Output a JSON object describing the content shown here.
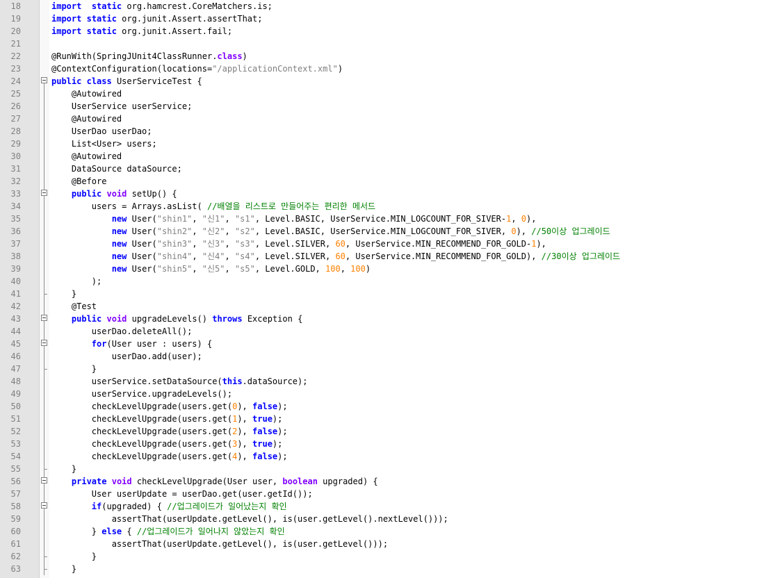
{
  "editor": {
    "colors": {
      "keyword": "#0000ff",
      "type_keyword": "#8000ff",
      "string": "#808080",
      "number": "#ff8000",
      "comment": "#008000",
      "gutter": "#e4e4e4"
    },
    "lines": [
      {
        "n": "18",
        "fold": "line",
        "tokens": [
          [
            "kw",
            "import"
          ],
          [
            "",
            "  "
          ],
          [
            "kw",
            "static"
          ],
          [
            "",
            " org.hamcrest.CoreMatchers.is;"
          ]
        ]
      },
      {
        "n": "19",
        "fold": "line",
        "tokens": [
          [
            "kw",
            "import"
          ],
          [
            "",
            " "
          ],
          [
            "kw",
            "static"
          ],
          [
            "",
            " org.junit.Assert.assertThat;"
          ]
        ]
      },
      {
        "n": "20",
        "fold": "line",
        "tokens": [
          [
            "kw",
            "import"
          ],
          [
            "",
            " "
          ],
          [
            "kw",
            "static"
          ],
          [
            "",
            " org.junit.Assert.fail;"
          ]
        ]
      },
      {
        "n": "21",
        "fold": "line",
        "tokens": []
      },
      {
        "n": "22",
        "fold": "line",
        "tokens": [
          [
            "",
            "@RunWith(SpringJUnit4ClassRunner."
          ],
          [
            "kw2",
            "class"
          ],
          [
            "",
            ")"
          ]
        ]
      },
      {
        "n": "23",
        "fold": "line",
        "tokens": [
          [
            "",
            "@ContextConfiguration(locations="
          ],
          [
            "str",
            "\"/applicationContext.xml\""
          ],
          [
            "",
            ")"
          ]
        ]
      },
      {
        "n": "24",
        "fold": "box-top",
        "tokens": [
          [
            "kw",
            "public"
          ],
          [
            "",
            " "
          ],
          [
            "kw",
            "class"
          ],
          [
            "",
            " UserServiceTest {"
          ]
        ]
      },
      {
        "n": "25",
        "fold": "line",
        "tokens": [
          [
            "",
            "    @Autowired"
          ]
        ]
      },
      {
        "n": "26",
        "fold": "line",
        "tokens": [
          [
            "",
            "    UserService userService;"
          ]
        ]
      },
      {
        "n": "27",
        "fold": "line",
        "tokens": [
          [
            "",
            "    @Autowired"
          ]
        ]
      },
      {
        "n": "28",
        "fold": "line",
        "tokens": [
          [
            "",
            "    UserDao userDao;"
          ]
        ]
      },
      {
        "n": "29",
        "fold": "line",
        "tokens": [
          [
            "",
            "    List<User> users;"
          ]
        ]
      },
      {
        "n": "30",
        "fold": "line",
        "tokens": [
          [
            "",
            "    @Autowired"
          ]
        ]
      },
      {
        "n": "31",
        "fold": "line",
        "tokens": [
          [
            "",
            "    DataSource dataSource;"
          ]
        ]
      },
      {
        "n": "32",
        "fold": "line",
        "tokens": [
          [
            "",
            "    @Before"
          ]
        ]
      },
      {
        "n": "33",
        "fold": "box",
        "tokens": [
          [
            "",
            "    "
          ],
          [
            "kw",
            "public"
          ],
          [
            "",
            " "
          ],
          [
            "kw2",
            "void"
          ],
          [
            "",
            " setUp() {"
          ]
        ]
      },
      {
        "n": "34",
        "fold": "line",
        "tokens": [
          [
            "",
            "        users = Arrays.asList( "
          ],
          [
            "cmt",
            "//배열을 리스트로 만들어주는 편리한 메서드"
          ]
        ]
      },
      {
        "n": "35",
        "fold": "line",
        "tokens": [
          [
            "",
            "            "
          ],
          [
            "kw",
            "new"
          ],
          [
            "",
            " User("
          ],
          [
            "str",
            "\"shin1\""
          ],
          [
            "",
            ", "
          ],
          [
            "str",
            "\"신1\""
          ],
          [
            "",
            ", "
          ],
          [
            "str",
            "\"s1\""
          ],
          [
            "",
            ", Level.BASIC, UserService.MIN_LOGCOUNT_FOR_SIVER-"
          ],
          [
            "num",
            "1"
          ],
          [
            "",
            ", "
          ],
          [
            "num",
            "0"
          ],
          [
            "",
            "),"
          ]
        ]
      },
      {
        "n": "36",
        "fold": "line",
        "tokens": [
          [
            "",
            "            "
          ],
          [
            "kw",
            "new"
          ],
          [
            "",
            " User("
          ],
          [
            "str",
            "\"shin2\""
          ],
          [
            "",
            ", "
          ],
          [
            "str",
            "\"신2\""
          ],
          [
            "",
            ", "
          ],
          [
            "str",
            "\"s2\""
          ],
          [
            "",
            ", Level.BASIC, UserService.MIN_LOGCOUNT_FOR_SIVER, "
          ],
          [
            "num",
            "0"
          ],
          [
            "",
            "), "
          ],
          [
            "cmt",
            "//50이상 업그레이드"
          ]
        ]
      },
      {
        "n": "37",
        "fold": "line",
        "tokens": [
          [
            "",
            "            "
          ],
          [
            "kw",
            "new"
          ],
          [
            "",
            " User("
          ],
          [
            "str",
            "\"shin3\""
          ],
          [
            "",
            ", "
          ],
          [
            "str",
            "\"신3\""
          ],
          [
            "",
            ", "
          ],
          [
            "str",
            "\"s3\""
          ],
          [
            "",
            ", Level.SILVER, "
          ],
          [
            "num",
            "60"
          ],
          [
            "",
            ", UserService.MIN_RECOMMEND_FOR_GOLD-"
          ],
          [
            "num",
            "1"
          ],
          [
            "",
            "),"
          ]
        ]
      },
      {
        "n": "38",
        "fold": "line",
        "tokens": [
          [
            "",
            "            "
          ],
          [
            "kw",
            "new"
          ],
          [
            "",
            " User("
          ],
          [
            "str",
            "\"shin4\""
          ],
          [
            "",
            ", "
          ],
          [
            "str",
            "\"신4\""
          ],
          [
            "",
            ", "
          ],
          [
            "str",
            "\"s4\""
          ],
          [
            "",
            ", Level.SILVER, "
          ],
          [
            "num",
            "60"
          ],
          [
            "",
            ", UserService.MIN_RECOMMEND_FOR_GOLD), "
          ],
          [
            "cmt",
            "//30이상 업그레이드"
          ]
        ]
      },
      {
        "n": "39",
        "fold": "line",
        "tokens": [
          [
            "",
            "            "
          ],
          [
            "kw",
            "new"
          ],
          [
            "",
            " User("
          ],
          [
            "str",
            "\"shin5\""
          ],
          [
            "",
            ", "
          ],
          [
            "str",
            "\"신5\""
          ],
          [
            "",
            ", "
          ],
          [
            "str",
            "\"s5\""
          ],
          [
            "",
            ", Level.GOLD, "
          ],
          [
            "num",
            "100"
          ],
          [
            "",
            ", "
          ],
          [
            "num",
            "100"
          ],
          [
            "",
            ")"
          ]
        ]
      },
      {
        "n": "40",
        "fold": "line",
        "tokens": [
          [
            "",
            "        );"
          ]
        ]
      },
      {
        "n": "41",
        "fold": "tee",
        "tokens": [
          [
            "",
            "    }"
          ]
        ]
      },
      {
        "n": "42",
        "fold": "line",
        "tokens": [
          [
            "",
            "    @Test"
          ]
        ]
      },
      {
        "n": "43",
        "fold": "box",
        "tokens": [
          [
            "",
            "    "
          ],
          [
            "kw",
            "public"
          ],
          [
            "",
            " "
          ],
          [
            "kw2",
            "void"
          ],
          [
            "",
            " upgradeLevels() "
          ],
          [
            "kw",
            "throws"
          ],
          [
            "",
            " Exception {"
          ]
        ]
      },
      {
        "n": "44",
        "fold": "line",
        "tokens": [
          [
            "",
            "        userDao.deleteAll();"
          ]
        ]
      },
      {
        "n": "45",
        "fold": "box",
        "tokens": [
          [
            "",
            "        "
          ],
          [
            "kw",
            "for"
          ],
          [
            "",
            "(User user : users) {"
          ]
        ]
      },
      {
        "n": "46",
        "fold": "line",
        "tokens": [
          [
            "",
            "            userDao.add(user);"
          ]
        ]
      },
      {
        "n": "47",
        "fold": "tee",
        "tokens": [
          [
            "",
            "        }"
          ]
        ]
      },
      {
        "n": "48",
        "fold": "line",
        "tokens": [
          [
            "",
            "        userService.setDataSource("
          ],
          [
            "kw",
            "this"
          ],
          [
            "",
            ".dataSource);"
          ]
        ]
      },
      {
        "n": "49",
        "fold": "line",
        "tokens": [
          [
            "",
            "        userService.upgradeLevels();"
          ]
        ]
      },
      {
        "n": "50",
        "fold": "line",
        "tokens": [
          [
            "",
            "        checkLevelUpgrade(users.get("
          ],
          [
            "num",
            "0"
          ],
          [
            "",
            "), "
          ],
          [
            "kw",
            "false"
          ],
          [
            "",
            ");"
          ]
        ]
      },
      {
        "n": "51",
        "fold": "line",
        "tokens": [
          [
            "",
            "        checkLevelUpgrade(users.get("
          ],
          [
            "num",
            "1"
          ],
          [
            "",
            "), "
          ],
          [
            "kw",
            "true"
          ],
          [
            "",
            ");"
          ]
        ]
      },
      {
        "n": "52",
        "fold": "line",
        "tokens": [
          [
            "",
            "        checkLevelUpgrade(users.get("
          ],
          [
            "num",
            "2"
          ],
          [
            "",
            "), "
          ],
          [
            "kw",
            "false"
          ],
          [
            "",
            ");"
          ]
        ]
      },
      {
        "n": "53",
        "fold": "line",
        "tokens": [
          [
            "",
            "        checkLevelUpgrade(users.get("
          ],
          [
            "num",
            "3"
          ],
          [
            "",
            "), "
          ],
          [
            "kw",
            "true"
          ],
          [
            "",
            ");"
          ]
        ]
      },
      {
        "n": "54",
        "fold": "line",
        "tokens": [
          [
            "",
            "        checkLevelUpgrade(users.get("
          ],
          [
            "num",
            "4"
          ],
          [
            "",
            "), "
          ],
          [
            "kw",
            "false"
          ],
          [
            "",
            ");"
          ]
        ]
      },
      {
        "n": "55",
        "fold": "tee",
        "tokens": [
          [
            "",
            "    }"
          ]
        ]
      },
      {
        "n": "56",
        "fold": "box",
        "tokens": [
          [
            "",
            "    "
          ],
          [
            "kw",
            "private"
          ],
          [
            "",
            " "
          ],
          [
            "kw2",
            "void"
          ],
          [
            "",
            " checkLevelUpgrade(User user, "
          ],
          [
            "kw2",
            "boolean"
          ],
          [
            "",
            " upgraded) {"
          ]
        ]
      },
      {
        "n": "57",
        "fold": "line",
        "tokens": [
          [
            "",
            "        User userUpdate = userDao.get(user.getId());"
          ]
        ]
      },
      {
        "n": "58",
        "fold": "box",
        "tokens": [
          [
            "",
            "        "
          ],
          [
            "kw",
            "if"
          ],
          [
            "",
            "(upgraded) { "
          ],
          [
            "cmt",
            "//업그레이드가 일어났는지 확인"
          ]
        ]
      },
      {
        "n": "59",
        "fold": "line",
        "tokens": [
          [
            "",
            "            assertThat(userUpdate.getLevel(), is(user.getLevel().nextLevel()));"
          ]
        ]
      },
      {
        "n": "60",
        "fold": "line",
        "tokens": [
          [
            "",
            "        } "
          ],
          [
            "kw",
            "else"
          ],
          [
            "",
            " { "
          ],
          [
            "cmt",
            "//업그레이드가 일어나지 않았는지 확인"
          ]
        ]
      },
      {
        "n": "61",
        "fold": "line",
        "tokens": [
          [
            "",
            "            assertThat(userUpdate.getLevel(), is(user.getLevel()));"
          ]
        ]
      },
      {
        "n": "62",
        "fold": "tee",
        "tokens": [
          [
            "",
            "        }"
          ]
        ]
      },
      {
        "n": "63",
        "fold": "tee",
        "tokens": [
          [
            "",
            "    }"
          ]
        ]
      }
    ]
  }
}
